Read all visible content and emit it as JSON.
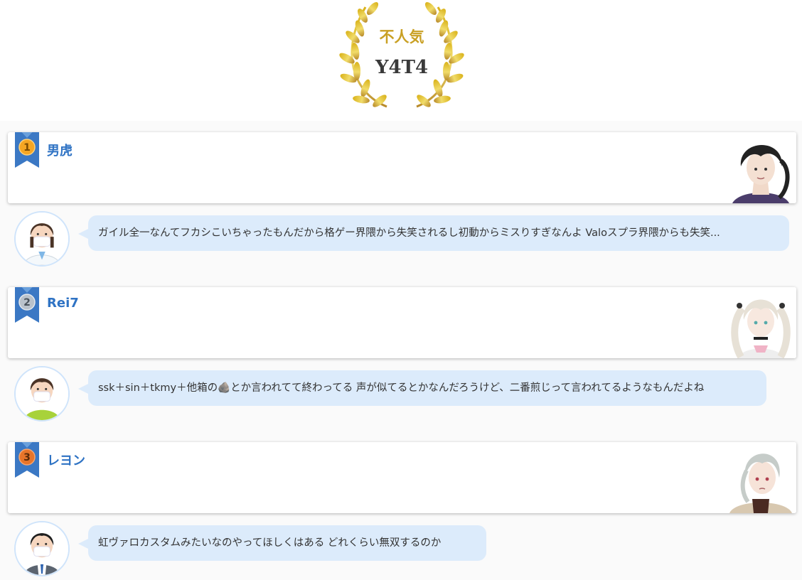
{
  "header": {
    "award_label": "不人気",
    "award_name": "Y4T4",
    "laurel_color": "#c9a024"
  },
  "ranking": [
    {
      "rank": "1",
      "rank_color": "#f5a623",
      "ribbon_color": "#3b78c4",
      "name": "男虎",
      "portrait_icon": "dark-haired-vtuber-portrait",
      "comment": "ガイル全一なんてフカシこいちゃったもんだから格ゲー界隈から失笑されるし初動からミスりすぎなんよ Valoスプラ界隈からも失笑...",
      "commenter_icon": "masked-doctor-avatar"
    },
    {
      "rank": "2",
      "rank_color": "#9aa5b1",
      "ribbon_color": "#3b78c4",
      "name": "Rei7",
      "portrait_icon": "white-haired-twintail-vtuber-portrait",
      "comment": "ssk＋sin＋tkmy＋他箱の🪨とか言われてて終わってる 声が似てるとかなんだろうけど、二番煎じって言われてるようなもんだよね",
      "commenter_icon": "masked-boy-avatar"
    },
    {
      "rank": "3",
      "rank_color": "#e8752a",
      "ribbon_color": "#3b78c4",
      "name": "レヨン",
      "portrait_icon": "silver-haired-vtuber-portrait",
      "comment": "虹ヴァロカスタムみたいなのやってほしくはある どれくらい無双するのか",
      "commenter_icon": "masked-businessman-avatar"
    }
  ]
}
